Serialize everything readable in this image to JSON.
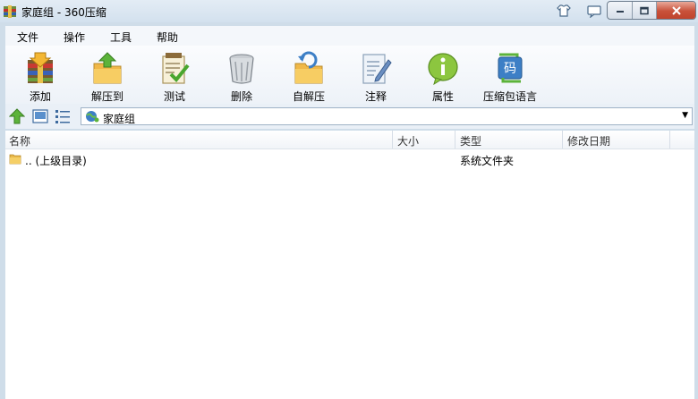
{
  "window": {
    "title": "家庭组 - 360压缩"
  },
  "menu": {
    "items": [
      "文件",
      "操作",
      "工具",
      "帮助"
    ]
  },
  "toolbar": {
    "items": [
      {
        "label": "添加",
        "icon": "add-archive-icon"
      },
      {
        "label": "解压到",
        "icon": "extract-to-icon"
      },
      {
        "label": "测试",
        "icon": "test-icon"
      },
      {
        "label": "删除",
        "icon": "delete-trash-icon"
      },
      {
        "label": "自解压",
        "icon": "self-extract-icon"
      },
      {
        "label": "注释",
        "icon": "comment-icon"
      },
      {
        "label": "属性",
        "icon": "info-icon"
      },
      {
        "label": "压缩包语言",
        "icon": "archive-language-icon"
      }
    ]
  },
  "address": {
    "path": "家庭组"
  },
  "columns": [
    "名称",
    "大小",
    "类型",
    "修改日期"
  ],
  "rows": [
    {
      "name": ".. (上级目录)",
      "size": "",
      "type": "系统文件夹",
      "modified": ""
    }
  ],
  "colors": {
    "window_frame": "#cfdde9",
    "accent_blue": "#3d7fc6",
    "close_red": "#c8513a"
  }
}
